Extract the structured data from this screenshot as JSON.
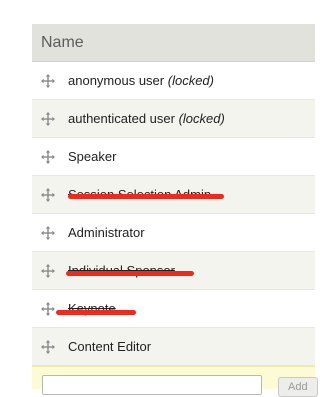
{
  "table": {
    "header": "Name",
    "rows": [
      {
        "label": "anonymous user",
        "suffix": "(locked)"
      },
      {
        "label": "authenticated user",
        "suffix": "(locked)"
      },
      {
        "label": "Speaker",
        "suffix": ""
      },
      {
        "label": "Session Selection Admin",
        "suffix": ""
      },
      {
        "label": "Administrator",
        "suffix": ""
      },
      {
        "label": "Individual Sponsor",
        "suffix": ""
      },
      {
        "label": "Keynote",
        "suffix": ""
      },
      {
        "label": "Content Editor",
        "suffix": ""
      }
    ]
  },
  "footer": {
    "new_role_value": "",
    "add_button_label": "Add"
  },
  "colors": {
    "header_bg": "#e1e2dc",
    "row_alt_bg": "#f3f4ee",
    "redaction": "#ee2a1f",
    "footer_bg": "#fcfbd6"
  },
  "icons": {
    "drag_handle": "move-cross-icon"
  }
}
